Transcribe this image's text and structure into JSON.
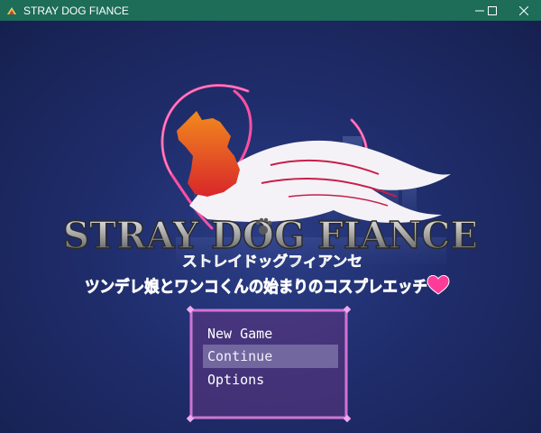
{
  "window": {
    "title": "STRAY DOG FIANCE",
    "controls": {
      "minimize": "minimize-icon",
      "maximize": "maximize-icon",
      "close": "close-icon"
    }
  },
  "logo": {
    "title": "STRAY DOG FIANCE",
    "katakana": "ストレイドッグフィアンセ",
    "subtitle": "ツンデレ娘とワンコくんの始まりのコスプレエッチ"
  },
  "menu": {
    "items": [
      {
        "label": "New Game"
      },
      {
        "label": "Continue",
        "selected": true
      },
      {
        "label": "Options"
      }
    ]
  },
  "colors": {
    "titlebar": "#1d6d58",
    "background": "#1f2d6c",
    "menu_border": "#d76fd8",
    "logo_pink": "#ff3b9a"
  }
}
